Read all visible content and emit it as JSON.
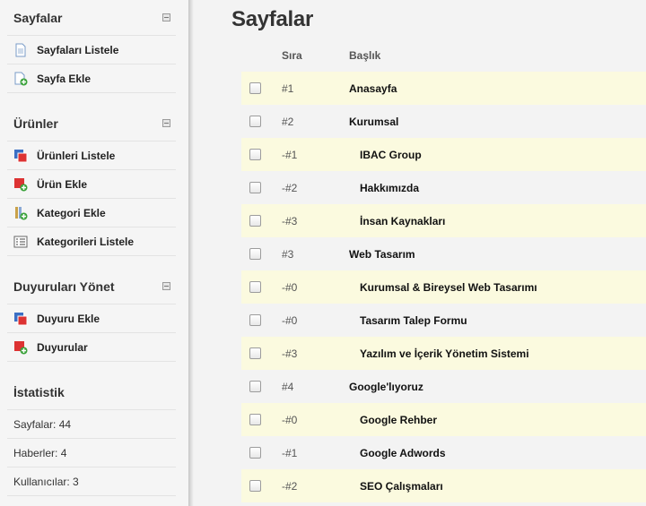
{
  "sidebar": {
    "sections": [
      {
        "title": "Sayfalar",
        "items": [
          {
            "label": "Sayfaları Listele",
            "icon": "page-icon"
          },
          {
            "label": "Sayfa Ekle",
            "icon": "page-add-icon"
          }
        ]
      },
      {
        "title": "Ürünler",
        "items": [
          {
            "label": "Ürünleri Listele",
            "icon": "products-icon"
          },
          {
            "label": "Ürün Ekle",
            "icon": "product-add-icon"
          },
          {
            "label": "Kategori Ekle",
            "icon": "category-add-icon"
          },
          {
            "label": "Kategorileri Listele",
            "icon": "list-icon"
          }
        ]
      },
      {
        "title": "Duyuruları Yönet",
        "items": [
          {
            "label": "Duyuru Ekle",
            "icon": "announcement-add-icon"
          },
          {
            "label": "Duyurular",
            "icon": "announcements-icon"
          }
        ]
      }
    ],
    "stats": {
      "title": "İstatistik",
      "items": [
        "Sayfalar: 44",
        "Haberler: 4",
        "Kullanıcılar: 3"
      ]
    }
  },
  "main": {
    "title": "Sayfalar",
    "columns": {
      "order": "Sıra",
      "title": "Başlık"
    },
    "rows": [
      {
        "order": "#1",
        "title": "Anasayfa",
        "sub": false
      },
      {
        "order": "#2",
        "title": "Kurumsal",
        "sub": false
      },
      {
        "order": "-#1",
        "title": "IBAC Group",
        "sub": true
      },
      {
        "order": "-#2",
        "title": "Hakkımızda",
        "sub": true
      },
      {
        "order": "-#3",
        "title": "İnsan Kaynakları",
        "sub": true
      },
      {
        "order": "#3",
        "title": "Web Tasarım",
        "sub": false
      },
      {
        "order": "-#0",
        "title": "Kurumsal & Bireysel Web Tasarımı",
        "sub": true
      },
      {
        "order": "-#0",
        "title": "Tasarım Talep Formu",
        "sub": true
      },
      {
        "order": "-#3",
        "title": "Yazılım ve İçerik Yönetim Sistemi",
        "sub": true
      },
      {
        "order": "#4",
        "title": "Google'lıyoruz",
        "sub": false
      },
      {
        "order": "-#0",
        "title": "Google Rehber",
        "sub": true
      },
      {
        "order": "-#1",
        "title": "Google Adwords",
        "sub": true
      },
      {
        "order": "-#2",
        "title": "SEO Çalışmaları",
        "sub": true
      }
    ]
  },
  "colors": {
    "row_highlight": "#fbfadf",
    "row_plain": "#f3f3f3",
    "sidebar_bg": "#f5f5f5"
  }
}
